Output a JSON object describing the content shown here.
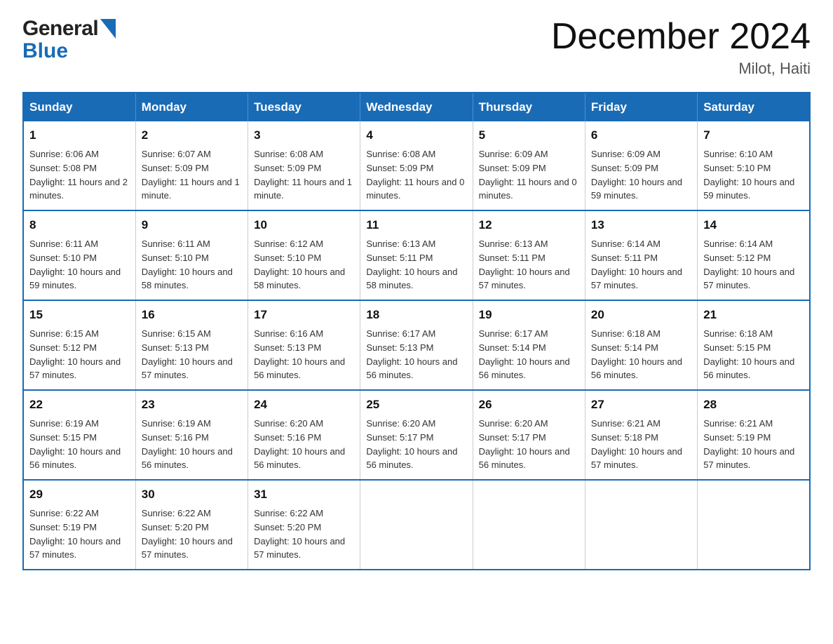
{
  "header": {
    "logo_general": "General",
    "logo_blue": "Blue",
    "title": "December 2024",
    "location": "Milot, Haiti"
  },
  "calendar": {
    "days": [
      "Sunday",
      "Monday",
      "Tuesday",
      "Wednesday",
      "Thursday",
      "Friday",
      "Saturday"
    ],
    "weeks": [
      [
        {
          "day": "1",
          "sunrise": "6:06 AM",
          "sunset": "5:08 PM",
          "daylight": "11 hours and 2 minutes."
        },
        {
          "day": "2",
          "sunrise": "6:07 AM",
          "sunset": "5:09 PM",
          "daylight": "11 hours and 1 minute."
        },
        {
          "day": "3",
          "sunrise": "6:08 AM",
          "sunset": "5:09 PM",
          "daylight": "11 hours and 1 minute."
        },
        {
          "day": "4",
          "sunrise": "6:08 AM",
          "sunset": "5:09 PM",
          "daylight": "11 hours and 0 minutes."
        },
        {
          "day": "5",
          "sunrise": "6:09 AM",
          "sunset": "5:09 PM",
          "daylight": "11 hours and 0 minutes."
        },
        {
          "day": "6",
          "sunrise": "6:09 AM",
          "sunset": "5:09 PM",
          "daylight": "10 hours and 59 minutes."
        },
        {
          "day": "7",
          "sunrise": "6:10 AM",
          "sunset": "5:10 PM",
          "daylight": "10 hours and 59 minutes."
        }
      ],
      [
        {
          "day": "8",
          "sunrise": "6:11 AM",
          "sunset": "5:10 PM",
          "daylight": "10 hours and 59 minutes."
        },
        {
          "day": "9",
          "sunrise": "6:11 AM",
          "sunset": "5:10 PM",
          "daylight": "10 hours and 58 minutes."
        },
        {
          "day": "10",
          "sunrise": "6:12 AM",
          "sunset": "5:10 PM",
          "daylight": "10 hours and 58 minutes."
        },
        {
          "day": "11",
          "sunrise": "6:13 AM",
          "sunset": "5:11 PM",
          "daylight": "10 hours and 58 minutes."
        },
        {
          "day": "12",
          "sunrise": "6:13 AM",
          "sunset": "5:11 PM",
          "daylight": "10 hours and 57 minutes."
        },
        {
          "day": "13",
          "sunrise": "6:14 AM",
          "sunset": "5:11 PM",
          "daylight": "10 hours and 57 minutes."
        },
        {
          "day": "14",
          "sunrise": "6:14 AM",
          "sunset": "5:12 PM",
          "daylight": "10 hours and 57 minutes."
        }
      ],
      [
        {
          "day": "15",
          "sunrise": "6:15 AM",
          "sunset": "5:12 PM",
          "daylight": "10 hours and 57 minutes."
        },
        {
          "day": "16",
          "sunrise": "6:15 AM",
          "sunset": "5:13 PM",
          "daylight": "10 hours and 57 minutes."
        },
        {
          "day": "17",
          "sunrise": "6:16 AM",
          "sunset": "5:13 PM",
          "daylight": "10 hours and 56 minutes."
        },
        {
          "day": "18",
          "sunrise": "6:17 AM",
          "sunset": "5:13 PM",
          "daylight": "10 hours and 56 minutes."
        },
        {
          "day": "19",
          "sunrise": "6:17 AM",
          "sunset": "5:14 PM",
          "daylight": "10 hours and 56 minutes."
        },
        {
          "day": "20",
          "sunrise": "6:18 AM",
          "sunset": "5:14 PM",
          "daylight": "10 hours and 56 minutes."
        },
        {
          "day": "21",
          "sunrise": "6:18 AM",
          "sunset": "5:15 PM",
          "daylight": "10 hours and 56 minutes."
        }
      ],
      [
        {
          "day": "22",
          "sunrise": "6:19 AM",
          "sunset": "5:15 PM",
          "daylight": "10 hours and 56 minutes."
        },
        {
          "day": "23",
          "sunrise": "6:19 AM",
          "sunset": "5:16 PM",
          "daylight": "10 hours and 56 minutes."
        },
        {
          "day": "24",
          "sunrise": "6:20 AM",
          "sunset": "5:16 PM",
          "daylight": "10 hours and 56 minutes."
        },
        {
          "day": "25",
          "sunrise": "6:20 AM",
          "sunset": "5:17 PM",
          "daylight": "10 hours and 56 minutes."
        },
        {
          "day": "26",
          "sunrise": "6:20 AM",
          "sunset": "5:17 PM",
          "daylight": "10 hours and 56 minutes."
        },
        {
          "day": "27",
          "sunrise": "6:21 AM",
          "sunset": "5:18 PM",
          "daylight": "10 hours and 57 minutes."
        },
        {
          "day": "28",
          "sunrise": "6:21 AM",
          "sunset": "5:19 PM",
          "daylight": "10 hours and 57 minutes."
        }
      ],
      [
        {
          "day": "29",
          "sunrise": "6:22 AM",
          "sunset": "5:19 PM",
          "daylight": "10 hours and 57 minutes."
        },
        {
          "day": "30",
          "sunrise": "6:22 AM",
          "sunset": "5:20 PM",
          "daylight": "10 hours and 57 minutes."
        },
        {
          "day": "31",
          "sunrise": "6:22 AM",
          "sunset": "5:20 PM",
          "daylight": "10 hours and 57 minutes."
        },
        null,
        null,
        null,
        null
      ]
    ]
  }
}
